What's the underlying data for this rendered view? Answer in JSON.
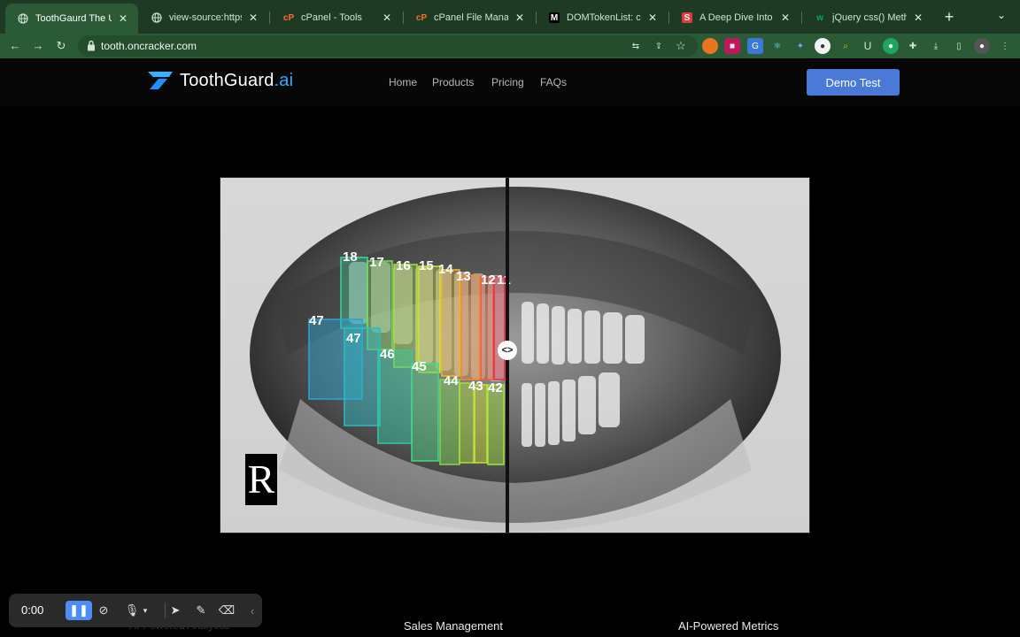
{
  "browser": {
    "tabs": [
      {
        "title": "ToothGaurd The Ultim",
        "favicon": "globe-icon",
        "active": true
      },
      {
        "title": "view-source:https://t",
        "favicon": "globe-icon",
        "active": false
      },
      {
        "title": "cPanel - Tools",
        "favicon": "cpanel-icon",
        "active": false
      },
      {
        "title": "cPanel File Manager",
        "favicon": "cpanel-icon",
        "active": false
      },
      {
        "title": "DOMTokenList: conta",
        "favicon": "mdn-icon",
        "active": false
      },
      {
        "title": "A Deep Dive Into obje",
        "favicon": "s-icon",
        "active": false
      },
      {
        "title": "jQuery css() Method",
        "favicon": "w3-icon",
        "active": false
      }
    ],
    "url": "tooth.oncracker.com",
    "colors": {
      "chrome": "#1e3a24",
      "toolbar": "#2b5b36"
    }
  },
  "site": {
    "logo_main": "ToothGuard",
    "logo_suffix": ".ai",
    "nav": [
      "Home",
      "Products",
      "Pricing",
      "FAQs"
    ],
    "cta": "Demo Test",
    "accent": "#4a79d8"
  },
  "xray": {
    "side_marker": "R",
    "slider_handle": "<>",
    "tooth_labels": [
      "18",
      "17",
      "16",
      "15",
      "14",
      "13",
      "12",
      "11",
      "47",
      "47",
      "46",
      "45",
      "44",
      "43",
      "42"
    ]
  },
  "features": {
    "left_partial": "AI-Powered Analytics",
    "middle": "Sales Management",
    "right": "AI-Powered Metrics"
  },
  "recorder": {
    "time": "0:00"
  }
}
